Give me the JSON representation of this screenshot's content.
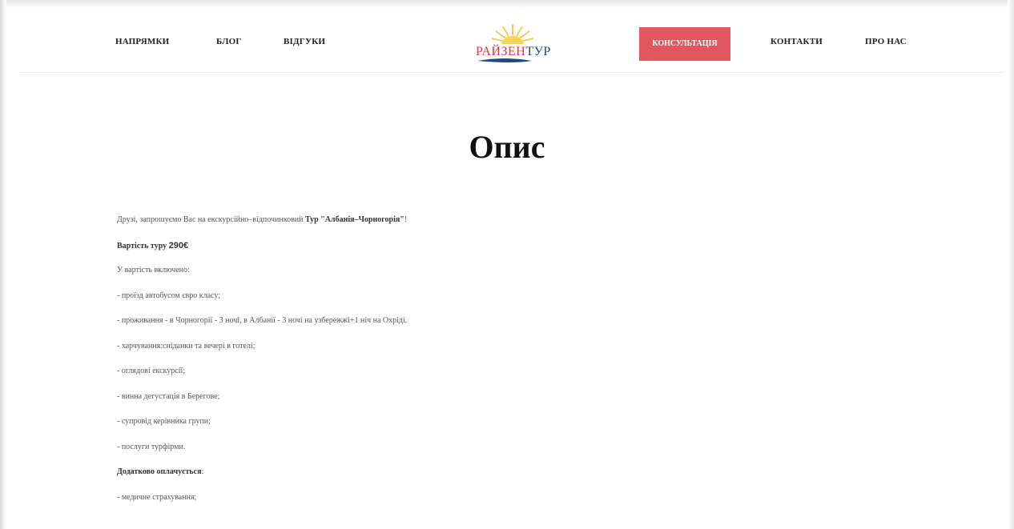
{
  "nav": {
    "left": [
      "НАПРЯМКИ",
      "БЛОГ",
      "ВІДГУКИ"
    ],
    "cta": "КОНСУЛЬТАЦІЯ",
    "right": [
      "КОНТАКТИ",
      "ПРО НАС"
    ]
  },
  "logo": {
    "part1": "РАЙЗЕН",
    "part2": "ТУР"
  },
  "colors": {
    "accent": "#e0575f",
    "logo_red": "#d8393e",
    "logo_blue": "#1f4a7a",
    "logo_sun": "#f2c431"
  },
  "page": {
    "title": "Опис"
  },
  "content": {
    "intro_prefix": "Друзі, запрошуємо Вас на екскурсійно–відпочинковий ",
    "intro_tour": "Тур \"Албанія–Чорногорія\"",
    "intro_suffix": "!",
    "price_label": "Вартість туру ",
    "price_value": "290€",
    "included_heading": "У вартість включено:",
    "included_items": [
      "- проїзд автобусом євро класу;",
      "- проживання - в Чорногорії - 3 ночі, в Албанії - 3 ночі на узбережжі+1 ніч на Охріді.",
      "- харчування:сніданки та вечері в готелі;",
      "- оглядові екскурсії;",
      "- винна дегустація в Берегове;",
      "- супровід керівника групи;",
      "- послуги турфірми."
    ],
    "extra_heading": "Додатково оплачується",
    "extra_heading_suffix": ":",
    "extra_items": [
      "- медичне страхування;"
    ]
  }
}
